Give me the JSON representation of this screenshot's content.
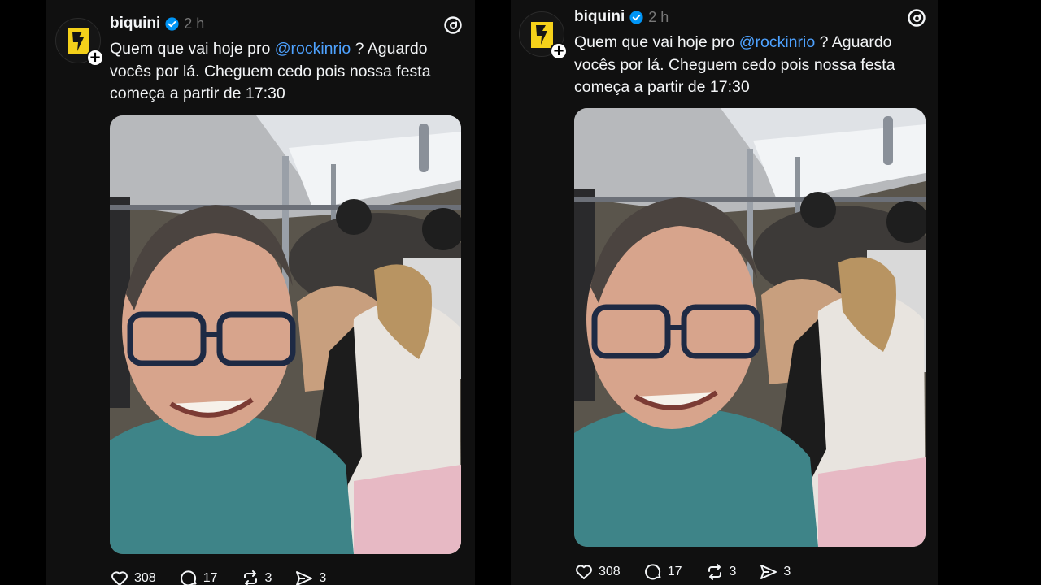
{
  "posts": [
    {
      "username": "biquini",
      "time": "2 h",
      "text_before": "Quem que vai hoje pro ",
      "mention": "@rockinrio",
      "text_after": " ? Aguardo vocês por lá. Cheguem cedo pois nossa festa começa a partir de 17:30",
      "likes": "308",
      "comments": "17",
      "reposts": "3",
      "shares": "3"
    },
    {
      "username": "biquini",
      "time": "2 h",
      "text_before": "Quem que vai hoje pro ",
      "mention": "@rockinrio",
      "text_after": " ? Aguardo vocês por lá. Cheguem cedo pois nossa festa começa a partir de 17:30",
      "likes": "308",
      "comments": "17",
      "reposts": "3",
      "shares": "3"
    }
  ],
  "icons": {
    "verified": "verified-badge-icon",
    "app": "threads-logo-icon",
    "like": "heart-icon",
    "comment": "comment-bubble-icon",
    "repost": "repost-icon",
    "share": "send-icon",
    "follow": "plus-icon"
  },
  "colors": {
    "background": "#101010",
    "mention": "#4ea2ff",
    "verified": "#0095f6",
    "logo_yellow": "#f5d11a"
  }
}
